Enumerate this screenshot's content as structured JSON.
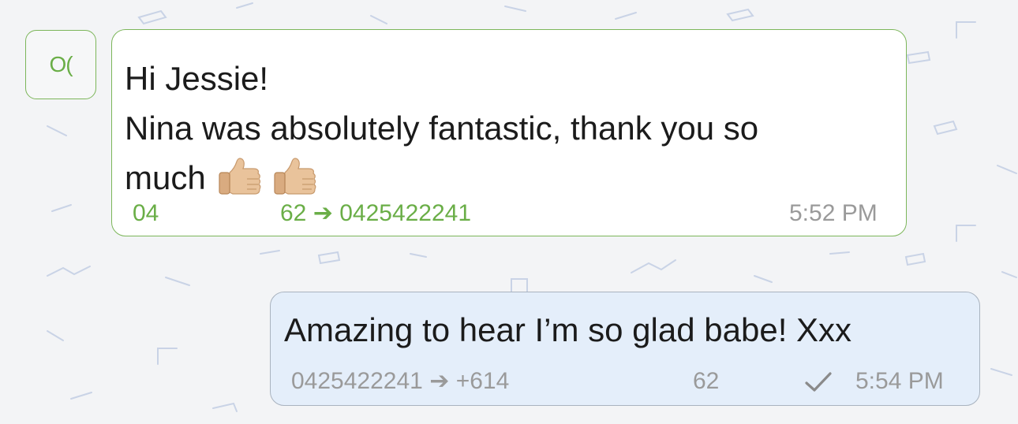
{
  "avatar": {
    "initials": "O("
  },
  "incoming": {
    "lines": [
      "Hi Jessie!",
      "Nina was absolutely fantastic, thank you so",
      "much"
    ],
    "emoji": [
      "thumbs-up-icon",
      "thumbs-up-icon"
    ],
    "from_prefix": "04",
    "from_suffix": "62",
    "arrow": "➔",
    "to_number": "0425422241",
    "time": "5:52 PM"
  },
  "outgoing": {
    "text": "Amazing to hear I’m so glad babe! Xxx",
    "from_number": "0425422241",
    "arrow": "➔",
    "to_prefix": "+614",
    "to_suffix": "62",
    "status_icon": "checkmark-icon",
    "time": "5:54 PM"
  },
  "colors": {
    "incoming_border": "#7cb65a",
    "incoming_meta": "#6aae47",
    "outgoing_bg": "#e4eefa",
    "outgoing_border": "#a9b3bf",
    "background": "#f3f4f6"
  }
}
